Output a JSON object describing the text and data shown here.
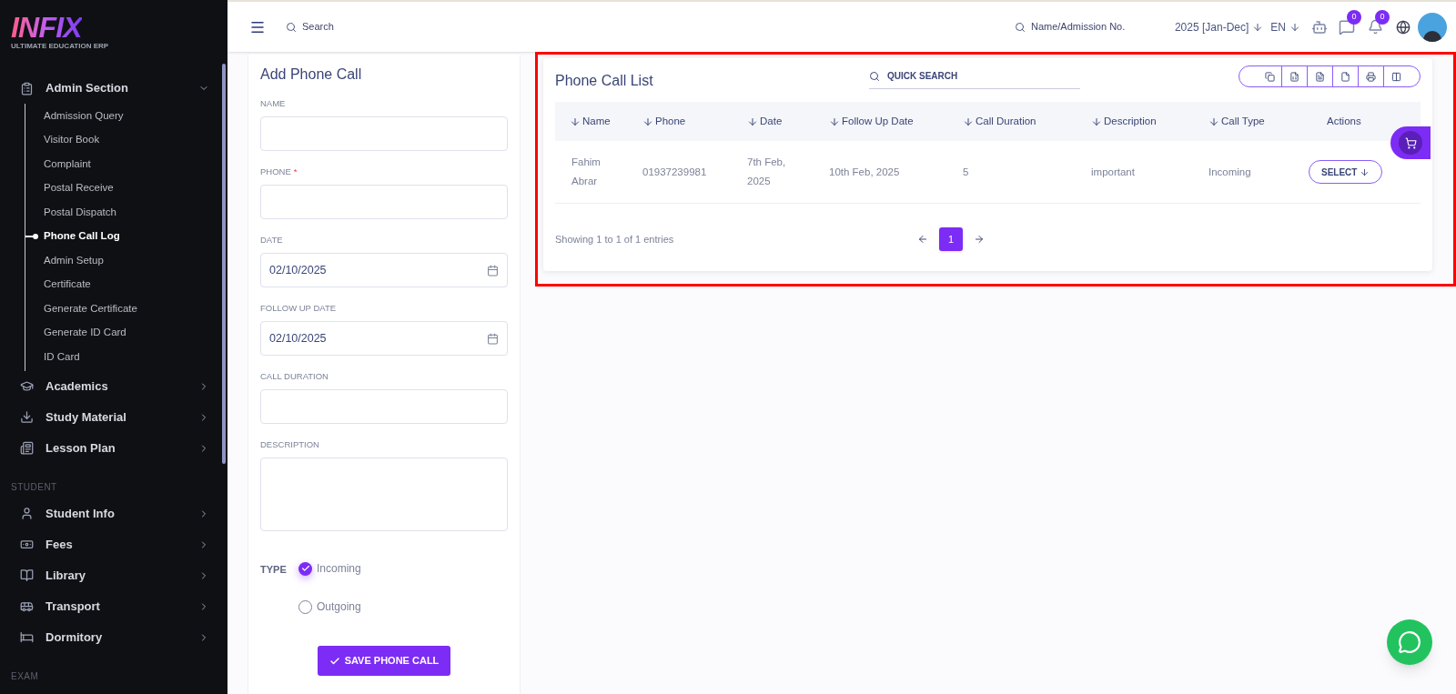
{
  "sidebar": {
    "logo": {
      "name": "INFIX",
      "tagline": "ULTIMATE EDUCATION ERP"
    },
    "sections": [
      {
        "items": [
          {
            "label": "Admin Section",
            "expanded": true,
            "children": [
              {
                "label": "Admission Query",
                "selected": false
              },
              {
                "label": "Visitor Book",
                "selected": false
              },
              {
                "label": "Complaint",
                "selected": false
              },
              {
                "label": "Postal Receive",
                "selected": false
              },
              {
                "label": "Postal Dispatch",
                "selected": false
              },
              {
                "label": "Phone Call Log",
                "selected": true
              },
              {
                "label": "Admin Setup",
                "selected": false
              },
              {
                "label": "Certificate",
                "selected": false
              },
              {
                "label": "Generate Certificate",
                "selected": false
              },
              {
                "label": "Generate ID Card",
                "selected": false
              },
              {
                "label": "ID Card",
                "selected": false
              }
            ]
          },
          {
            "label": "Academics",
            "expanded": false
          },
          {
            "label": "Study Material",
            "expanded": false
          },
          {
            "label": "Lesson Plan",
            "expanded": false
          }
        ]
      },
      {
        "title": "STUDENT",
        "items": [
          {
            "label": "Student Info",
            "expanded": false
          },
          {
            "label": "Fees",
            "expanded": false
          },
          {
            "label": "Library",
            "expanded": false
          },
          {
            "label": "Transport",
            "expanded": false
          },
          {
            "label": "Dormitory",
            "expanded": false
          }
        ]
      },
      {
        "title": "EXAM"
      }
    ]
  },
  "topbar": {
    "search": {
      "placeholder": "Search"
    },
    "student_search": {
      "placeholder": "Name/Admission No."
    },
    "session": "2025 [Jan-Dec]",
    "language": "EN",
    "message_count": "0",
    "notification_count": "0"
  },
  "form": {
    "title": "Add Phone Call",
    "fields": [
      {
        "label": "NAME",
        "kind": "text"
      },
      {
        "label": "PHONE",
        "required_mark": "*",
        "kind": "text"
      },
      {
        "label": "DATE",
        "kind": "date",
        "value": "02/10/2025"
      },
      {
        "label": "FOLLOW UP DATE",
        "kind": "date",
        "value": "02/10/2025"
      },
      {
        "label": "CALL DURATION",
        "kind": "text"
      },
      {
        "label": "DESCRIPTION",
        "kind": "textarea"
      }
    ],
    "type": {
      "label": "TYPE",
      "options": [
        {
          "label": "Incoming",
          "selected": true
        },
        {
          "label": "Outgoing",
          "selected": false
        }
      ]
    },
    "submit": "SAVE PHONE CALL"
  },
  "list": {
    "title": "Phone Call List",
    "quick_search": {
      "placeholder": "QUICK SEARCH"
    },
    "columns": [
      {
        "label": "Name",
        "sortable": true
      },
      {
        "label": "Phone",
        "sortable": true
      },
      {
        "label": "Date",
        "sortable": true
      },
      {
        "label": "Follow Up Date",
        "sortable": true
      },
      {
        "label": "Call Duration",
        "sortable": true
      },
      {
        "label": "Description",
        "sortable": true
      },
      {
        "label": "Call Type",
        "sortable": true
      },
      {
        "label": "Actions",
        "sortable": false
      }
    ],
    "rows": [
      {
        "cells": [
          "Fahim Abrar",
          "01937239981",
          "7th Feb, 2025",
          "10th Feb, 2025",
          "5",
          "important",
          "Incoming"
        ],
        "action": "SELECT"
      }
    ],
    "footer": "Showing 1 to 1 of 1 entries",
    "pages": [
      {
        "label": "1",
        "selected": true
      }
    ]
  }
}
